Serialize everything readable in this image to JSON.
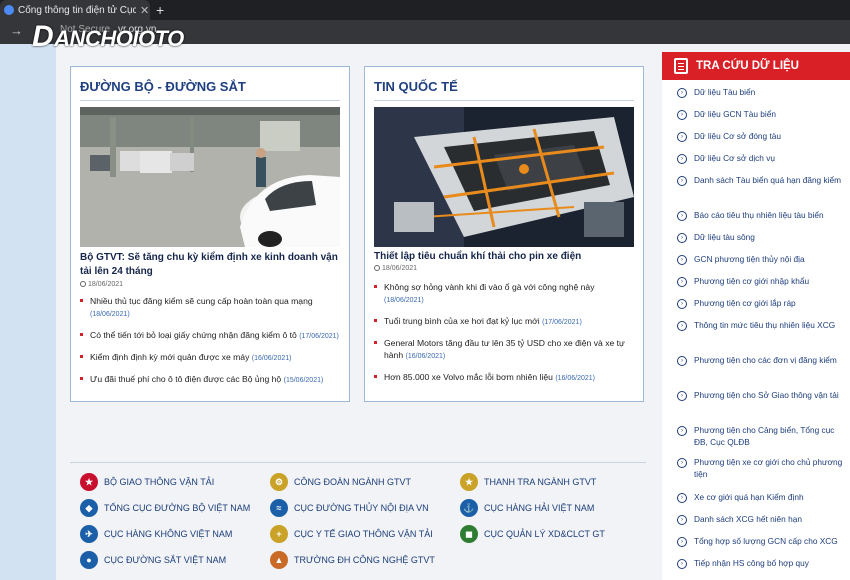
{
  "browser": {
    "tab_title": "Cổng thông tin điện tử Cục Đă",
    "tab_close": "✕",
    "new_tab": "+",
    "address_prefix": "Not Secure",
    "address_url": "vr.org.vn"
  },
  "watermark": {
    "logo_mark": "D",
    "text": "ANCHOIOTO"
  },
  "panels": [
    {
      "title": "ĐƯỜNG BỘ - ĐƯỜNG SẮT",
      "headline": "Bộ GTVT: Sẽ tăng chu kỳ kiểm định xe kinh doanh vận tải lên 24 tháng",
      "headline_date": "18/06/2021",
      "items": [
        {
          "text": "Nhiều thủ tục đăng kiểm sẽ cung cấp hoàn toàn qua mạng",
          "date": "(18/06/2021)"
        },
        {
          "text": "Có thể tiến tới bỏ loại giấy chứng nhận đăng kiểm ô tô",
          "date": "(17/06/2021)"
        },
        {
          "text": "Kiểm định định kỳ mới quản được xe máy",
          "date": "(16/06/2021)"
        },
        {
          "text": "Ưu đãi thuế phí cho ô tô điện được các Bộ ủng hộ",
          "date": "(15/06/2021)"
        }
      ]
    },
    {
      "title": "TIN QUỐC TẾ",
      "headline": "Thiết lập tiêu chuẩn khí thải cho pin xe điện",
      "headline_date": "18/06/2021",
      "items": [
        {
          "text": "Không sợ hỏng vành khi đi vào ổ gà với công nghệ này",
          "date": "(18/06/2021)"
        },
        {
          "text": "Tuổi trung bình của xe hơi đạt kỷ lục mới",
          "date": "(17/06/2021)"
        },
        {
          "text": "General Motors tăng đầu tư lên 35 tỷ USD cho xe điện và xe tự hành",
          "date": "(16/06/2021)"
        },
        {
          "text": "Hơn 85.000 xe Volvo mắc lỗi bơm nhiên liệu",
          "date": "(16/06/2021)"
        }
      ]
    }
  ],
  "links": [
    {
      "label": "BỘ GIAO THÔNG VẬN TẢI",
      "color": "#c8102e"
    },
    {
      "label": "CÔNG ĐOÀN NGÀNH GTVT",
      "color": "#c9a227"
    },
    {
      "label": "THANH TRA NGÀNH GTVT",
      "color": "#c9a227"
    },
    {
      "label": "TỔNG CỤC ĐƯỜNG BỘ VIỆT NAM",
      "color": "#1b5fa8"
    },
    {
      "label": "CỤC ĐƯỜNG THỦY NỘI ĐỊA VN",
      "color": "#1b5fa8"
    },
    {
      "label": "CỤC HÀNG HẢI VIỆT NAM",
      "color": "#1b5fa8"
    },
    {
      "label": "CỤC HÀNG KHÔNG VIỆT NAM",
      "color": "#1b5fa8"
    },
    {
      "label": "CỤC Y TẾ GIAO THÔNG VẬN TẢI",
      "color": "#c9a227"
    },
    {
      "label": "CỤC QUẢN LÝ XD&CLCT GT",
      "color": "#2e7d32"
    },
    {
      "label": "CỤC ĐƯỜNG SẮT VIỆT NAM",
      "color": "#1b5fa8"
    },
    {
      "label": "TRƯỜNG ĐH CÔNG NGHỆ GTVT",
      "color": "#c96b27"
    }
  ],
  "sidebar": {
    "title": "TRA CỨU DỮ LIỆU",
    "items": [
      "Dữ liệu Tàu biển",
      "Dữ liệu GCN Tàu biển",
      "Dữ liệu Cơ sở đóng tàu",
      "Dữ liệu Cơ sở dịch vụ",
      "Danh sách Tàu biển quá hạn đăng kiểm",
      "Báo cáo tiêu thụ nhiên liệu tàu biển",
      "Dữ liệu tàu sông",
      "GCN phương tiện thủy nội địa",
      "Phương tiện cơ giới nhập khẩu",
      "Phương tiện cơ giới lắp ráp",
      "Thông tin mức tiêu thụ nhiên liệu XCG",
      "Phương tiện cho các đơn vị đăng kiểm",
      "Phương tiện cho Sở Giao thông vận tải",
      "Phương tiện cho Cảng biển, Tổng cục ĐB, Cục QLĐB",
      "Phương tiện xe cơ giới cho chủ phương tiện",
      "Xe cơ giới quá hạn Kiểm định",
      "Danh sách XCG hết niên hạn",
      "Tổng hợp số lượng GCN cấp cho XCG",
      "Tiếp nhận HS công bố hợp quy"
    ]
  }
}
